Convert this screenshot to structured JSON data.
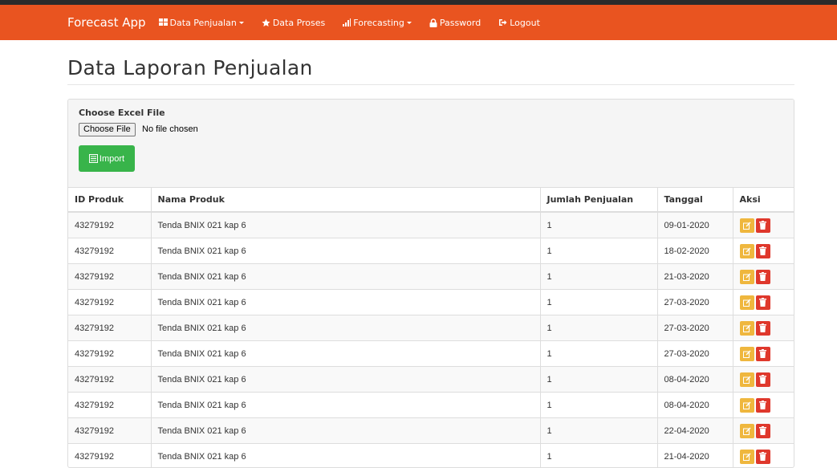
{
  "navbar": {
    "brand": "Forecast App",
    "items": [
      {
        "label": "Data Penjualan",
        "icon": "grid-icon",
        "dropdown": true
      },
      {
        "label": "Data Proses",
        "icon": "star-icon",
        "dropdown": false
      },
      {
        "label": "Forecasting",
        "icon": "signal-icon",
        "dropdown": true
      },
      {
        "label": "Password",
        "icon": "lock-icon",
        "dropdown": false
      },
      {
        "label": "Logout",
        "icon": "logout-icon",
        "dropdown": false
      }
    ]
  },
  "page": {
    "title": "Data Laporan Penjualan"
  },
  "upload": {
    "label": "Choose Excel File",
    "file_button": "Choose File",
    "file_status": "No file chosen",
    "import_label": "Import"
  },
  "table": {
    "headers": [
      "ID Produk",
      "Nama Produk",
      "Jumlah Penjualan",
      "Tanggal",
      "Aksi"
    ],
    "rows": [
      {
        "id": "43279192",
        "nama": "Tenda BNIX 021 kap 6",
        "jumlah": "1",
        "tanggal": "09-01-2020"
      },
      {
        "id": "43279192",
        "nama": "Tenda BNIX 021 kap 6",
        "jumlah": "1",
        "tanggal": "18-02-2020"
      },
      {
        "id": "43279192",
        "nama": "Tenda BNIX 021 kap 6",
        "jumlah": "1",
        "tanggal": "21-03-2020"
      },
      {
        "id": "43279192",
        "nama": "Tenda BNIX 021 kap 6",
        "jumlah": "1",
        "tanggal": "27-03-2020"
      },
      {
        "id": "43279192",
        "nama": "Tenda BNIX 021 kap 6",
        "jumlah": "1",
        "tanggal": "27-03-2020"
      },
      {
        "id": "43279192",
        "nama": "Tenda BNIX 021 kap 6",
        "jumlah": "1",
        "tanggal": "27-03-2020"
      },
      {
        "id": "43279192",
        "nama": "Tenda BNIX 021 kap 6",
        "jumlah": "1",
        "tanggal": "08-04-2020"
      },
      {
        "id": "43279192",
        "nama": "Tenda BNIX 021 kap 6",
        "jumlah": "1",
        "tanggal": "08-04-2020"
      },
      {
        "id": "43279192",
        "nama": "Tenda BNIX 021 kap 6",
        "jumlah": "1",
        "tanggal": "22-04-2020"
      },
      {
        "id": "43279192",
        "nama": "Tenda BNIX 021 kap 6",
        "jumlah": "1",
        "tanggal": "21-04-2020"
      }
    ]
  },
  "colors": {
    "navbar": "#e95420",
    "import_button": "#38b44a",
    "edit_button": "#efb73e",
    "delete_button": "#df382c"
  }
}
